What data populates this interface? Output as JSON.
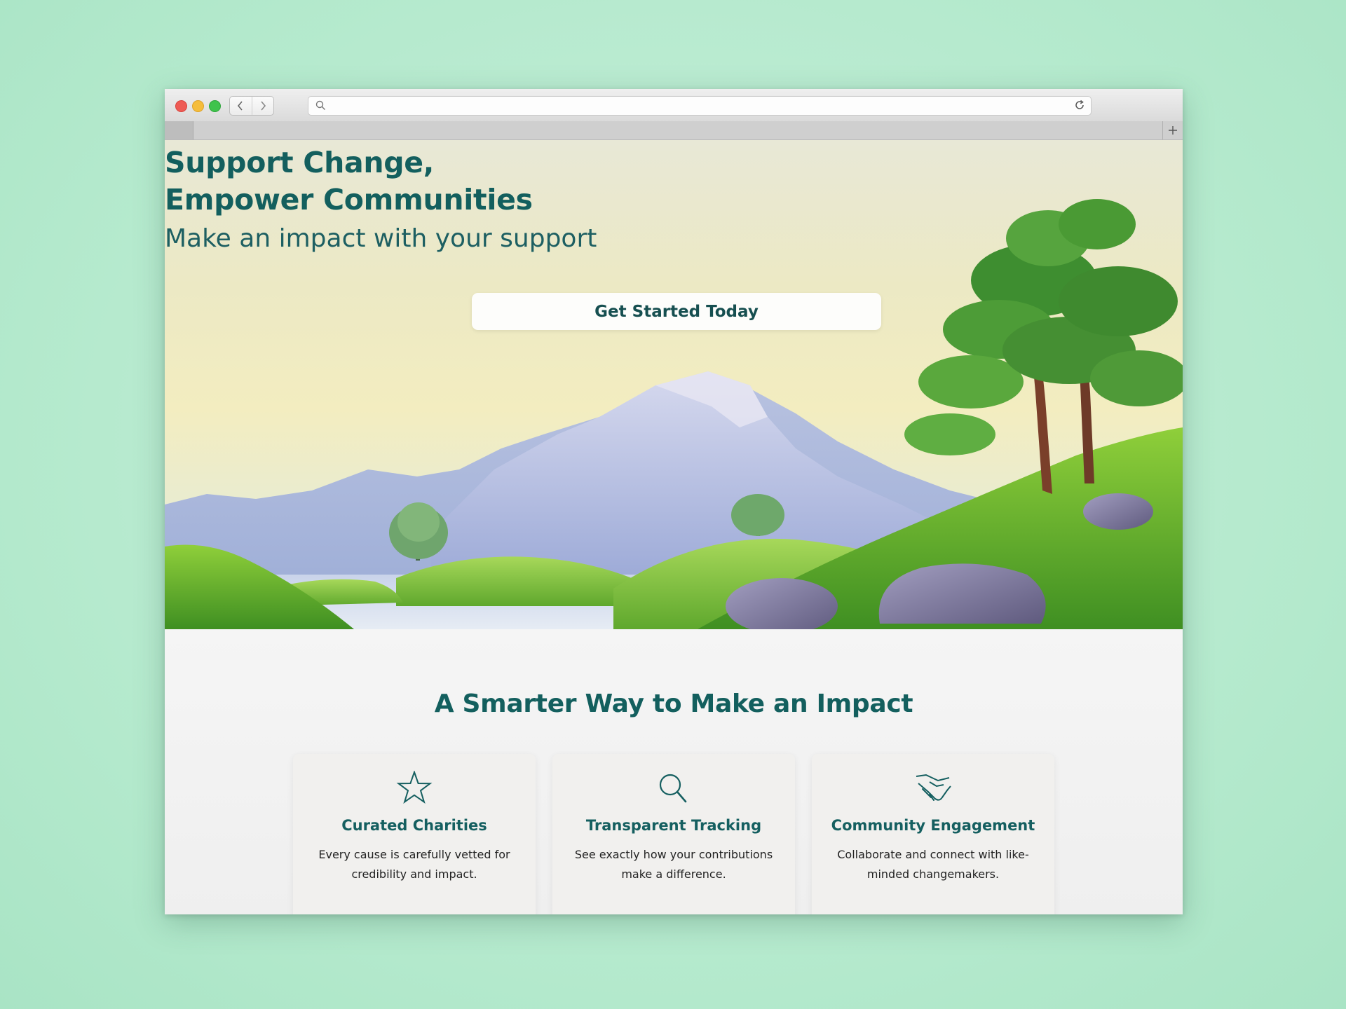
{
  "browser": {
    "url_placeholder": "",
    "icons": [
      "back-icon",
      "forward-icon",
      "search-icon",
      "reload-icon",
      "plus-icon"
    ]
  },
  "hero": {
    "title_line1": "Support Change,",
    "title_line2": "Empower Communities",
    "subtitle": "Make an impact with your support",
    "cta_label": "Get Started Today"
  },
  "features": {
    "title": "A Smarter Way to Make an Impact",
    "cards": [
      {
        "icon": "star-icon",
        "title": "Curated Charities",
        "description": "Every cause is carefully vetted for credibility and impact."
      },
      {
        "icon": "magnifier-icon",
        "title": "Transparent Tracking",
        "description": "See exactly how your contributions make a difference."
      },
      {
        "icon": "handshake-icon",
        "title": "Community Engagement",
        "description": "Collaborate and connect with like-minded changemakers."
      }
    ]
  },
  "colors": {
    "brand": "#135f5e",
    "background": "#b3e9cc",
    "card": "#f1f0ee"
  }
}
